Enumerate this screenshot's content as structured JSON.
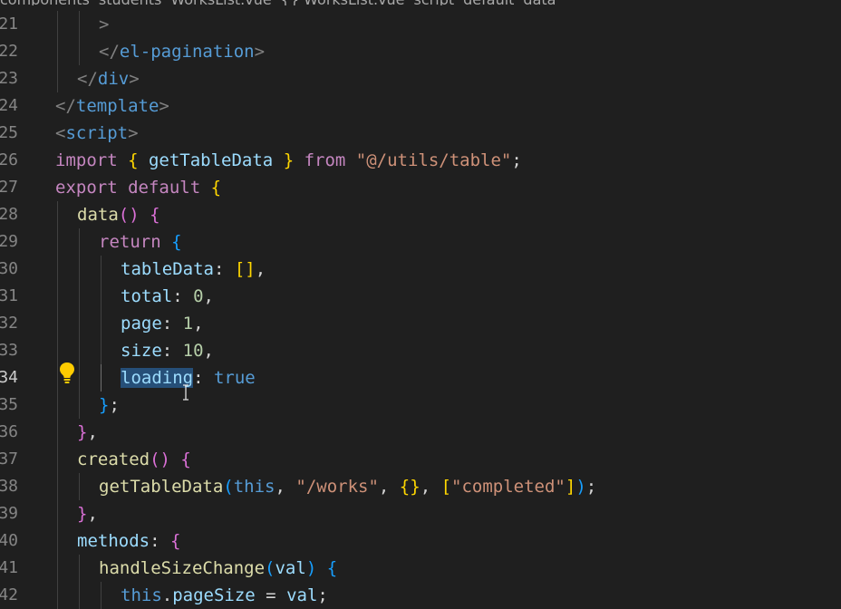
{
  "breadcrumb": [
    "components",
    "students",
    "WorksList.vue",
    "{} WorksList.vue",
    "script",
    "default",
    "data"
  ],
  "lines": [
    {
      "num": "21",
      "indent": 2,
      "tokens": [
        {
          "t": ">",
          "c": "punc"
        }
      ]
    },
    {
      "num": "22",
      "indent": 2,
      "tokens": [
        {
          "t": "</",
          "c": "punc"
        },
        {
          "t": "el-pagination",
          "c": "tag"
        },
        {
          "t": ">",
          "c": "punc"
        }
      ]
    },
    {
      "num": "23",
      "indent": 1,
      "tokens": [
        {
          "t": "</",
          "c": "punc"
        },
        {
          "t": "div",
          "c": "tag"
        },
        {
          "t": ">",
          "c": "punc"
        }
      ]
    },
    {
      "num": "24",
      "indent": 0,
      "tokens": [
        {
          "t": "</",
          "c": "punc"
        },
        {
          "t": "template",
          "c": "tag"
        },
        {
          "t": ">",
          "c": "punc"
        }
      ]
    },
    {
      "num": "25",
      "indent": 0,
      "tokens": [
        {
          "t": "<",
          "c": "punc"
        },
        {
          "t": "script",
          "c": "tag"
        },
        {
          "t": ">",
          "c": "punc"
        }
      ]
    },
    {
      "num": "26",
      "indent": 0,
      "tokens": [
        {
          "t": "import ",
          "c": "kw"
        },
        {
          "t": "{",
          "c": "b1"
        },
        {
          "t": " getTableData ",
          "c": "var"
        },
        {
          "t": "}",
          "c": "b1"
        },
        {
          "t": " from ",
          "c": "kw"
        },
        {
          "t": "\"@/utils/table\"",
          "c": "str"
        },
        {
          "t": ";",
          "c": "plain"
        }
      ]
    },
    {
      "num": "27",
      "indent": 0,
      "tokens": [
        {
          "t": "export default ",
          "c": "kw"
        },
        {
          "t": "{",
          "c": "b1"
        }
      ]
    },
    {
      "num": "28",
      "indent": 1,
      "tokens": [
        {
          "t": "data",
          "c": "fn"
        },
        {
          "t": "()",
          "c": "b2"
        },
        {
          "t": " ",
          "c": "plain"
        },
        {
          "t": "{",
          "c": "b2"
        }
      ]
    },
    {
      "num": "29",
      "indent": 2,
      "tokens": [
        {
          "t": "return ",
          "c": "kw"
        },
        {
          "t": "{",
          "c": "b3"
        }
      ]
    },
    {
      "num": "30",
      "indent": 3,
      "tokens": [
        {
          "t": "tableData",
          "c": "var"
        },
        {
          "t": ": ",
          "c": "plain"
        },
        {
          "t": "[]",
          "c": "b1"
        },
        {
          "t": ",",
          "c": "plain"
        }
      ]
    },
    {
      "num": "31",
      "indent": 3,
      "tokens": [
        {
          "t": "total",
          "c": "var"
        },
        {
          "t": ": ",
          "c": "plain"
        },
        {
          "t": "0",
          "c": "num"
        },
        {
          "t": ",",
          "c": "plain"
        }
      ]
    },
    {
      "num": "32",
      "indent": 3,
      "tokens": [
        {
          "t": "page",
          "c": "var"
        },
        {
          "t": ": ",
          "c": "plain"
        },
        {
          "t": "1",
          "c": "num"
        },
        {
          "t": ",",
          "c": "plain"
        }
      ]
    },
    {
      "num": "33",
      "indent": 3,
      "tokens": [
        {
          "t": "size",
          "c": "var"
        },
        {
          "t": ": ",
          "c": "plain"
        },
        {
          "t": "10",
          "c": "num"
        },
        {
          "t": ",",
          "c": "plain"
        }
      ]
    },
    {
      "num": "34",
      "indent": 3,
      "active": true,
      "tokens": [
        {
          "t": "loading",
          "c": "var",
          "hl": true
        },
        {
          "t": ": ",
          "c": "plain"
        },
        {
          "t": "true",
          "c": "blue"
        }
      ]
    },
    {
      "num": "35",
      "indent": 2,
      "tokens": [
        {
          "t": "}",
          "c": "b3"
        },
        {
          "t": ";",
          "c": "plain"
        }
      ]
    },
    {
      "num": "36",
      "indent": 1,
      "tokens": [
        {
          "t": "}",
          "c": "b2"
        },
        {
          "t": ",",
          "c": "plain"
        }
      ]
    },
    {
      "num": "37",
      "indent": 1,
      "tokens": [
        {
          "t": "created",
          "c": "fn"
        },
        {
          "t": "()",
          "c": "b2"
        },
        {
          "t": " ",
          "c": "plain"
        },
        {
          "t": "{",
          "c": "b2"
        }
      ]
    },
    {
      "num": "38",
      "indent": 2,
      "tokens": [
        {
          "t": "getTableData",
          "c": "fn"
        },
        {
          "t": "(",
          "c": "b3"
        },
        {
          "t": "this",
          "c": "blue"
        },
        {
          "t": ", ",
          "c": "plain"
        },
        {
          "t": "\"/works\"",
          "c": "str"
        },
        {
          "t": ", ",
          "c": "plain"
        },
        {
          "t": "{}",
          "c": "b1"
        },
        {
          "t": ", ",
          "c": "plain"
        },
        {
          "t": "[",
          "c": "b1"
        },
        {
          "t": "\"completed\"",
          "c": "str"
        },
        {
          "t": "]",
          "c": "b1"
        },
        {
          "t": ")",
          "c": "b3"
        },
        {
          "t": ";",
          "c": "plain"
        }
      ]
    },
    {
      "num": "39",
      "indent": 1,
      "tokens": [
        {
          "t": "}",
          "c": "b2"
        },
        {
          "t": ",",
          "c": "plain"
        }
      ]
    },
    {
      "num": "40",
      "indent": 1,
      "tokens": [
        {
          "t": "methods",
          "c": "var"
        },
        {
          "t": ": ",
          "c": "plain"
        },
        {
          "t": "{",
          "c": "b2"
        }
      ]
    },
    {
      "num": "41",
      "indent": 2,
      "tokens": [
        {
          "t": "handleSizeChange",
          "c": "fn"
        },
        {
          "t": "(",
          "c": "b3"
        },
        {
          "t": "val",
          "c": "var"
        },
        {
          "t": ")",
          "c": "b3"
        },
        {
          "t": " ",
          "c": "plain"
        },
        {
          "t": "{",
          "c": "b3"
        }
      ]
    },
    {
      "num": "42",
      "indent": 3,
      "tokens": [
        {
          "t": "this",
          "c": "blue"
        },
        {
          "t": ".",
          "c": "plain"
        },
        {
          "t": "pageSize",
          "c": "var"
        },
        {
          "t": " = ",
          "c": "plain"
        },
        {
          "t": "val",
          "c": "var"
        },
        {
          "t": ";",
          "c": "plain"
        }
      ]
    }
  ],
  "colors": {
    "background": "#1f1f1f",
    "keyword": "#c586c0",
    "tag": "#569cd6",
    "variable": "#9cdcfe",
    "function": "#dcdcaa",
    "string": "#ce9178",
    "number": "#b5cea8",
    "selection": "#264f78",
    "bracket_gold": "#ffd700",
    "bracket_pink": "#da70d6",
    "bracket_blue": "#179fff"
  },
  "icons": {
    "lightbulb": "lightbulb-icon",
    "cursor": "text-cursor-icon"
  }
}
